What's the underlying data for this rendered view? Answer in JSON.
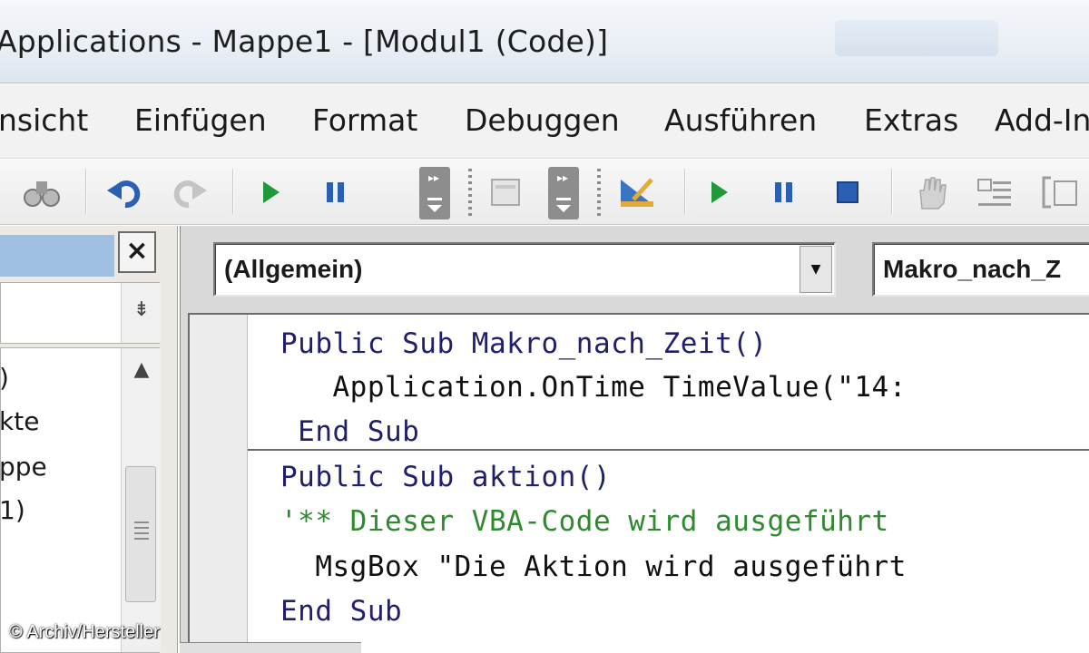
{
  "window": {
    "title": "Applications - Mappe1 - [Modul1 (Code)]"
  },
  "menubar": {
    "items": [
      {
        "label": "nsicht"
      },
      {
        "label": "Einfügen"
      },
      {
        "label": "Format"
      },
      {
        "label": "Debuggen"
      },
      {
        "label": "Ausführen"
      },
      {
        "label": "Extras"
      },
      {
        "label": "Add-In"
      }
    ]
  },
  "toolbar": {
    "icons": [
      "binoculars-icon",
      "undo-icon",
      "redo-icon",
      "run-icon",
      "pause-icon",
      "run-icon",
      "pause-icon",
      "stop-icon",
      "design-mode-icon",
      "hand-icon",
      "indent-icon",
      "outdent-icon"
    ]
  },
  "project_panel": {
    "close_label": "×",
    "tree_items": [
      {
        "label": ")"
      },
      {
        "label": "kte"
      },
      {
        "label": "ppe"
      },
      {
        "label": "1)"
      }
    ]
  },
  "code_window": {
    "object_combo": "(Allgemein)",
    "procedure_combo": "Makro_nach_Z",
    "lines": [
      {
        "text": "Public Sub Makro_nach_Zeit()",
        "style": "kw"
      },
      {
        "text": "   Application.OnTime TimeValue(\"14:",
        "style": "normal"
      },
      {
        "text": " End Sub",
        "style": "kw"
      },
      {
        "text": "Public Sub aktion()",
        "style": "kw"
      },
      {
        "text": "'** Dieser VBA-Code wird ausgeführt",
        "style": "comment"
      },
      {
        "text": "  MsgBox \"Die Aktion wird ausgeführt",
        "style": "normal"
      },
      {
        "text": "End Sub",
        "style": "kw"
      }
    ]
  },
  "watermark": "© Archiv/Hersteller",
  "colors": {
    "keyword": "#1f1f6e",
    "comment": "#2f8a2f",
    "run_green": "#1f9a3a",
    "pause_blue": "#2b5fb4"
  }
}
